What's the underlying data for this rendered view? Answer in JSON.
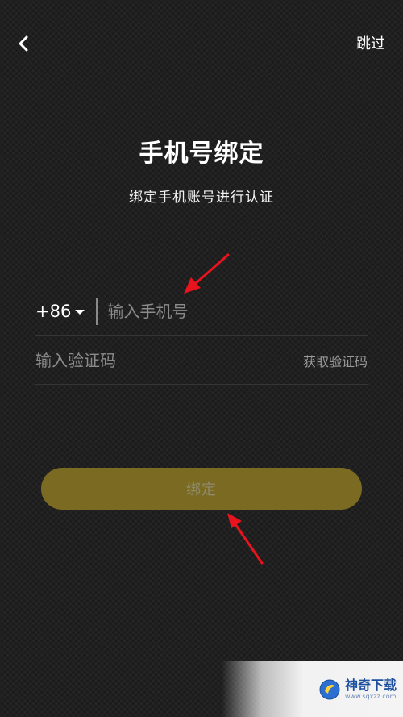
{
  "header": {
    "back_icon": "chevron-left-icon",
    "skip_label": "跳过"
  },
  "title": "手机号绑定",
  "subtitle": "绑定手机账号进行认证",
  "phone": {
    "country_code": "+86",
    "caret_icon": "caret-down-icon",
    "placeholder": "输入手机号",
    "value": ""
  },
  "code": {
    "placeholder": "输入验证码",
    "value": "",
    "get_code_label": "获取验证码"
  },
  "bind_button_label": "绑定",
  "colors": {
    "background": "#1b1b1b",
    "button": "#7b6b22",
    "button_text": "#8f8a6e",
    "annotation_arrow": "#e8141d",
    "watermark_brand": "#1c4f9e"
  },
  "watermark": {
    "name": "神奇下载",
    "url": "www.sqxzz.com"
  }
}
